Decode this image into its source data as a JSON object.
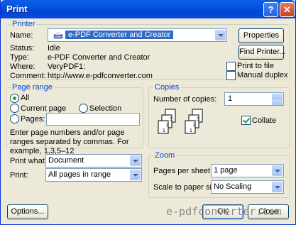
{
  "window": {
    "title": "Print",
    "help_glyph": "?",
    "close_glyph": "✕"
  },
  "printer": {
    "group_label": "Printer",
    "name_label": "Name:",
    "name_value": "e-PDF Converter and Creator",
    "status_label": "Status:",
    "status_value": "Idle",
    "type_label": "Type:",
    "type_value": "e-PDF Converter and Creator",
    "where_label": "Where:",
    "where_value": "VeryPDF1:",
    "comment_label": "Comment:",
    "comment_value": "http://www.e-pdfconverter.com",
    "properties_button": "Properties",
    "find_printer_button": "Find Printer...",
    "print_to_file_label": "Print to file",
    "print_to_file_checked": false,
    "manual_duplex_label": "Manual duplex",
    "manual_duplex_checked": false
  },
  "page_range": {
    "group_label": "Page range",
    "all_label": "All",
    "current_page_label": "Current page",
    "selection_label": "Selection",
    "pages_label": "Pages:",
    "pages_value": "",
    "selected": "all",
    "hint": "Enter page numbers and/or page ranges separated by commas.  For example, 1,3,5–12"
  },
  "copies": {
    "group_label": "Copies",
    "number_label": "Number of copies:",
    "number_value": "1",
    "collate_label": "Collate",
    "collate_checked": true,
    "page_numbers": [
      "1",
      "2",
      "3"
    ]
  },
  "print_what": {
    "label": "Print what:",
    "value": "Document"
  },
  "print": {
    "label": "Print:",
    "value": "All pages in range"
  },
  "zoom": {
    "group_label": "Zoom",
    "pages_per_sheet_label": "Pages per sheet:",
    "pages_per_sheet_value": "1 page",
    "scale_label": "Scale to paper size:",
    "scale_value": "No Scaling"
  },
  "buttons": {
    "options": "Options...",
    "ok": "OK",
    "close": "Close"
  },
  "watermark": "e-pdfconverter.com",
  "colors": {
    "title_bar": "#0553e1",
    "accent_blue": "#0046d5",
    "face": "#ece9d8",
    "selection": "#316ac5"
  }
}
